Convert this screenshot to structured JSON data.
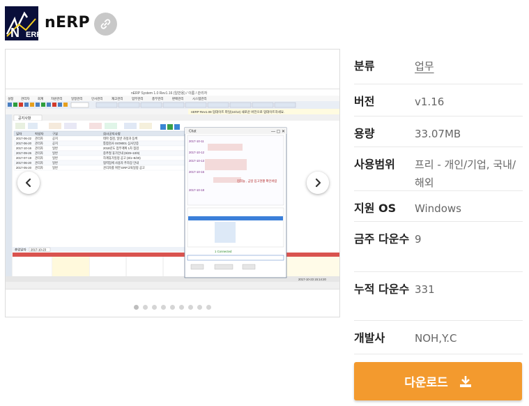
{
  "app": {
    "name": "nERP",
    "logo_text": "nERP"
  },
  "screenshot": {
    "title_bar": "nERP System  1.0  Rev1.16 (일반용)  / 이름 / 관리자",
    "menu_items": [
      "설정",
      "관리자",
      "회계",
      "자원관리",
      "일정관리",
      "인사관리",
      "재고관리",
      "업무관리",
      "총무관리",
      "판매관리",
      "시스템관리"
    ],
    "tab_label": "공지사항",
    "grid_headers": [
      "일자",
      "작성자",
      "구분",
      "회사공지사항"
    ],
    "grid_rows": [
      [
        "2017-06-22",
        "관리자",
        "공지",
        "테마 점검, 일반 과정과 등록"
      ],
      [
        "2017-06-20",
        "관리자",
        "공지",
        "통합검사 ISO9001 심사인증"
      ],
      [
        "2017-10-16",
        "관리자",
        "일반",
        "2018년도 업무계획 1차 점검"
      ],
      [
        "2017-09-26",
        "관리자",
        "일반",
        "중추절 휴가안내 (9/29~10/9)"
      ],
      [
        "2017-07-19",
        "관리자",
        "일반",
        "하계휴가일정 공고 (8/1~8/20)"
      ],
      [
        "2017-06-20",
        "관리자",
        "일반",
        "협력업체 사용자 주차장 안내"
      ],
      [
        "2017-05-20",
        "관리자",
        "일반",
        "관리자를 위한 ERP교육일정 공고"
      ]
    ],
    "schedule_label": "총업일자",
    "schedule_date": "2017-10-23",
    "chat_title": "Chat",
    "chat_message": "김하늘 , 금일 입고현황 확인바랍",
    "chat_connected": "1 Connected",
    "status_bar": "2017-10-23  15:14:20"
  },
  "carousel": {
    "dot_count": 9,
    "active_dot": 0
  },
  "info": [
    {
      "label": "분류",
      "value": "업무",
      "link": true
    },
    {
      "label": "버전",
      "value": "v1.16",
      "link": false
    },
    {
      "label": "용량",
      "value": "33.07MB",
      "link": false
    },
    {
      "label": "사용범위",
      "value": "프리 - 개인/기업, 국내/해외",
      "link": false
    },
    {
      "label": "지원 OS",
      "value": "Windows",
      "link": false
    },
    {
      "label": "금주 다운수",
      "value": "9",
      "link": false
    },
    {
      "label": "누적 다운수",
      "value": "331",
      "link": false
    },
    {
      "label": "개발사",
      "value": "NOH,Y.C",
      "link": false
    }
  ],
  "download": {
    "label": "다운로드"
  },
  "colors": {
    "accent": "#f39a2e",
    "logo_bg": "#0a0f3a"
  }
}
